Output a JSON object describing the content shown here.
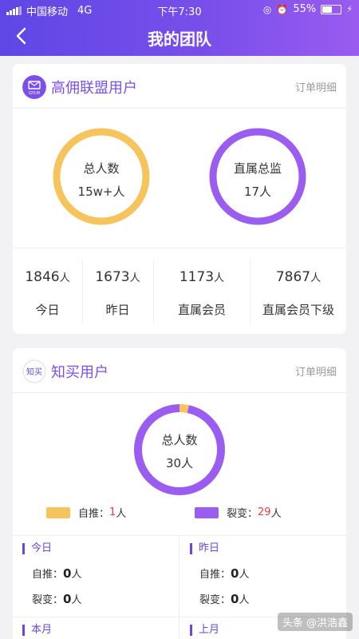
{
  "status_bar": {
    "carrier": "中国移动",
    "network": "4G",
    "time": "下午7:30",
    "battery_pct": "55%",
    "battery_level": 0.55
  },
  "nav": {
    "title": "我的团队"
  },
  "gylm": {
    "title": "高佣联盟用户",
    "logo_text": "GYLM",
    "link": "订单明细",
    "ring_total": {
      "label": "总人数",
      "value": "15w+人"
    },
    "ring_direct": {
      "label": "直属总监",
      "value": "17人"
    },
    "stats": [
      {
        "num": "1846",
        "unit": "人",
        "label": "今日"
      },
      {
        "num": "1673",
        "unit": "人",
        "label": "昨日"
      },
      {
        "num": "1173",
        "unit": "人",
        "label": "直属会员"
      },
      {
        "num": "7867",
        "unit": "人",
        "label": "直属会员下级"
      }
    ],
    "colors": {
      "ring_total": "#f5c45c",
      "ring_direct": "#9b5cf0"
    }
  },
  "zhimai": {
    "title": "知买用户",
    "logo_text": "知买",
    "link": "订单明细",
    "ring": {
      "label": "总人数",
      "value": "30人"
    },
    "chart_data": {
      "type": "pie",
      "categories": [
        "自推",
        "裂变"
      ],
      "values": [
        1,
        29
      ]
    },
    "legend": [
      {
        "label": "自推：",
        "value": "1",
        "unit": "人",
        "color": "#f5c45c"
      },
      {
        "label": "裂变：",
        "value": "29",
        "unit": "人",
        "color": "#9b5cf0"
      }
    ],
    "periods": [
      {
        "title": "今日",
        "self_label": "自推：",
        "self_value": "0",
        "fission_label": "裂变：",
        "fission_value": "0",
        "unit": "人"
      },
      {
        "title": "昨日",
        "self_label": "自推：",
        "self_value": "0",
        "fission_label": "裂变：",
        "fission_value": "0",
        "unit": "人"
      },
      {
        "title": "本月"
      },
      {
        "title": "上月"
      }
    ]
  },
  "watermark": "头条 @洪浩鑫"
}
